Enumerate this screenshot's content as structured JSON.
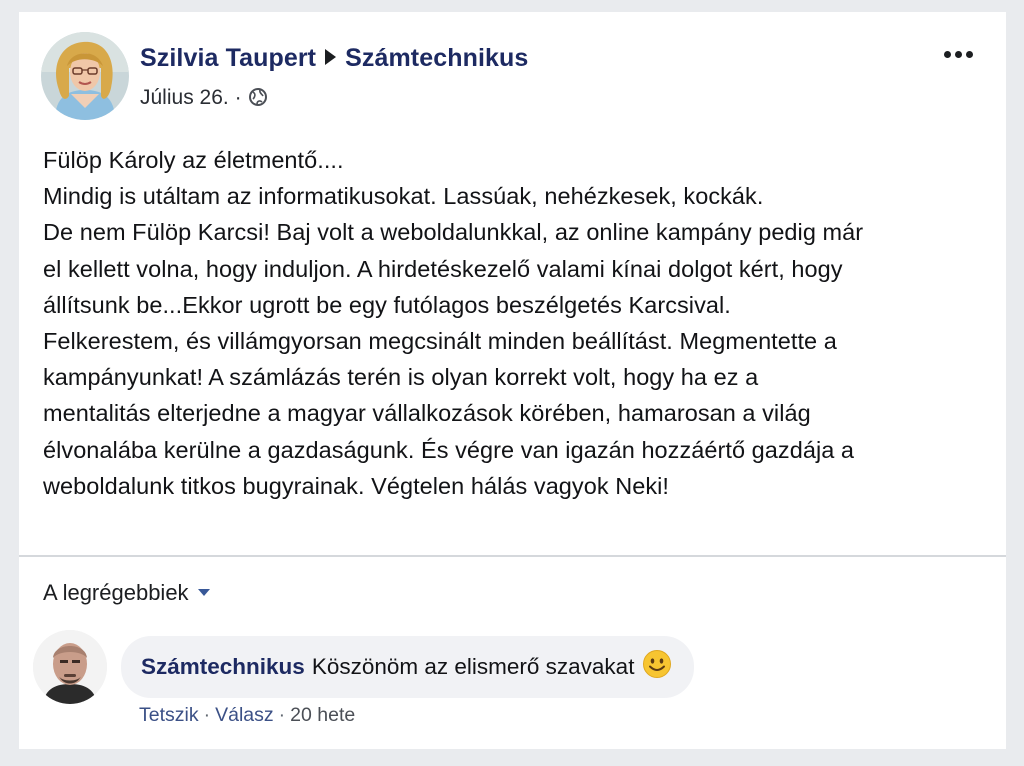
{
  "post": {
    "author": "Szilvia Taupert",
    "target_page": "Számtechnikus",
    "date": "Július 26.",
    "date_separator": "·",
    "privacy_icon": "globe-icon",
    "more_icon": "more-options-icon",
    "body_lines": [
      "Fülöp Károly az életmentő....",
      "Mindig is utáltam az informatikusokat. Lassúak, nehézkesek, kockák.",
      "De nem Fülöp Karcsi! Baj volt a weboldalunkkal, az online kampány pedig már",
      "el kellett volna, hogy induljon. A hirdetéskezelő valami kínai dolgot kért, hogy",
      "állítsunk be...Ekkor ugrott be egy futólagos beszélgetés Karcsival.",
      "Felkerestem, és villámgyorsan megcsinált minden beállítást. Megmentette a",
      "kampányunkat! A számlázás terén is olyan korrekt volt, hogy ha ez a",
      "mentalitás elterjedne a magyar vállalkozások körében, hamarosan a világ",
      "élvonalába kerülne a gazdaságunk. És végre van igazán hozzáértő gazdája a",
      "weboldalunk titkos bugyrainak. Végtelen hálás vagyok Neki!"
    ]
  },
  "comments": {
    "sort_label": "A legrégebbiek",
    "items": [
      {
        "author": "Számtechnikus",
        "text": "Köszönöm az elismerő szavakat",
        "emoji": "smiling-face-emoji",
        "like_label": "Tetszik",
        "reply_label": "Válasz",
        "separator": "·",
        "time": "20 hete"
      }
    ]
  },
  "colors": {
    "page_background": "#e9ebee",
    "card_background": "#ffffff",
    "name_link": "#1d2a62",
    "action_link": "#3b5086",
    "comment_bubble": "#f1f2f5",
    "divider": "#d5d8dc"
  }
}
